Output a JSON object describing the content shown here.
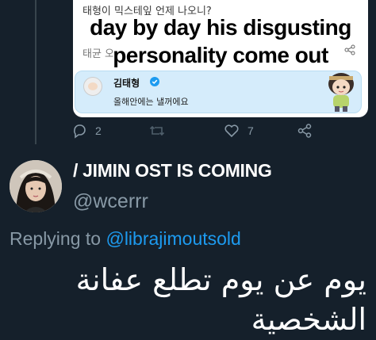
{
  "quoted": {
    "korean_top": "태형이 믹스테잎 언제 나오니?",
    "caption_line1": "day by day his disgusting",
    "caption_line2": "personality come out",
    "korean_sub": "태균 오",
    "reply_name": "김태형",
    "reply_text": "올해안에는 낼꺼에요"
  },
  "actions": {
    "reply_count": "2",
    "retweet_count": "",
    "like_count": "7"
  },
  "tweet": {
    "display_name": "/ JIMIN OST IS COMING",
    "handle": "@wcerrr",
    "replying_prefix": "Replying to ",
    "replying_to": "@librajimoutsold",
    "text": "يوم عن يوم تطلع عفانة الشخصية"
  },
  "colors": {
    "background": "#15202b",
    "muted": "#8899a6",
    "link": "#1d9bf0"
  }
}
